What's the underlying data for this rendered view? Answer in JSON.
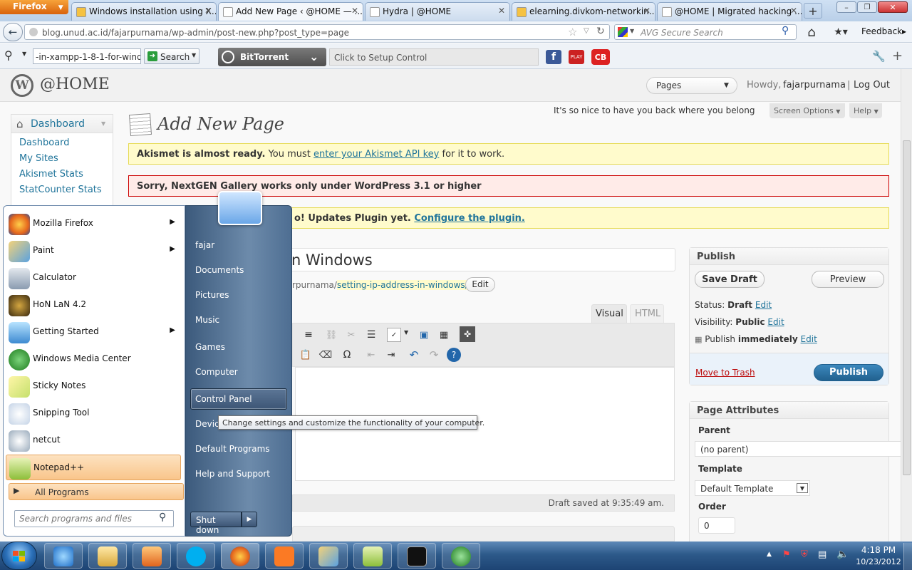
{
  "browser": {
    "app_button": "Firefox",
    "tabs": [
      {
        "label": "Windows installation using X..."
      },
      {
        "label": "Add New Page ‹ @HOME — ..."
      },
      {
        "label": "Hydra | @HOME"
      },
      {
        "label": "elearning.divkom-networkin..."
      },
      {
        "label": "@HOME | Migrated hacking ..."
      }
    ],
    "url": "blog.unud.ac.id/fajarpurnama/wp-admin/post-new.php?post_type=page",
    "search_placeholder": "AVG Secure Search",
    "feedback": "Feedback",
    "toolbar_search_value": "-in-xampp-1-8-1-for-wind",
    "toolbar_search_button": "Search",
    "bittorrent_label": "BitTorrent",
    "bittorrent_setup": "Click to Setup Control"
  },
  "wp": {
    "site_title": "@HOME",
    "pages_dropdown": "Pages",
    "howdy": "Howdy,",
    "username": "fajarpurnama",
    "separator": "|",
    "logout": "Log Out",
    "welcome": "It's so nice to have you back where you belong",
    "screen_options": "Screen Options",
    "help": "Help",
    "page_heading": "Add New Page",
    "sidebar": {
      "section": "Dashboard",
      "items": [
        {
          "label": "Dashboard"
        },
        {
          "label": "My Sites"
        },
        {
          "label": "Akismet Stats"
        },
        {
          "label": "StatCounter Stats"
        }
      ]
    },
    "notices": {
      "akismet_bold": "Akismet is almost ready.",
      "akismet_text": "You must",
      "akismet_link": "enter your Akismet API key",
      "akismet_tail": "for it to work.",
      "nextgen": "Sorry, NextGEN Gallery works only under WordPress 3.1 or higher",
      "plugin_text": "o! Updates Plugin yet.",
      "plugin_link": "Configure the plugin."
    },
    "post_title": "n Windows",
    "permalink_prefix": "rpurnama/",
    "permalink_slug": "setting-ip-address-in-windows/",
    "permalink_edit": "Edit",
    "editor_tabs": {
      "visual": "Visual",
      "html": "HTML"
    },
    "draft_saved": "Draft saved at 9:35:49 am.",
    "publish": {
      "title": "Publish",
      "save_draft": "Save Draft",
      "preview": "Preview",
      "status_label": "Status:",
      "status_value": "Draft",
      "visibility_label": "Visibility:",
      "visibility_value": "Public",
      "publish_label": "Publish",
      "publish_value": "immediately",
      "edit": "Edit",
      "trash": "Move to Trash",
      "publish_button": "Publish"
    },
    "page_attributes": {
      "title": "Page Attributes",
      "parent_label": "Parent",
      "parent_value": "(no parent)",
      "template_label": "Template",
      "template_value": "Default Template",
      "order_label": "Order",
      "order_value": "0"
    }
  },
  "start_menu": {
    "programs": [
      {
        "label": "Mozilla Firefox",
        "arrow": true
      },
      {
        "label": "Paint",
        "arrow": true
      },
      {
        "label": "Calculator",
        "arrow": false
      },
      {
        "label": "HoN LaN 4.2",
        "arrow": false
      },
      {
        "label": "Getting Started",
        "arrow": true
      },
      {
        "label": "Windows Media Center",
        "arrow": false
      },
      {
        "label": "Sticky Notes",
        "arrow": false
      },
      {
        "label": "Snipping Tool",
        "arrow": false
      },
      {
        "label": "netcut",
        "arrow": false
      },
      {
        "label": "Notepad++",
        "arrow": false
      }
    ],
    "all_programs": "All Programs",
    "search_placeholder": "Search programs and files",
    "right_links": [
      {
        "label": "fajar"
      },
      {
        "label": "Documents"
      },
      {
        "label": "Pictures"
      },
      {
        "label": "Music"
      },
      {
        "label": "Games"
      },
      {
        "label": "Computer"
      },
      {
        "label": "Control Panel"
      },
      {
        "label": "Devic"
      },
      {
        "label": "Default Programs"
      },
      {
        "label": "Help and Support"
      }
    ],
    "shutdown": "Shut down",
    "tooltip": "Change settings and customize the functionality of your computer."
  },
  "taskbar": {
    "time": "4:18 PM",
    "date": "10/23/2012"
  },
  "colors": {
    "wp_link": "#21759b",
    "publish_blue": "#2a6f9e",
    "notice_yellow": "#fffbcc",
    "notice_red": "#ffebe8",
    "taskbar": "#2d5a8a"
  }
}
